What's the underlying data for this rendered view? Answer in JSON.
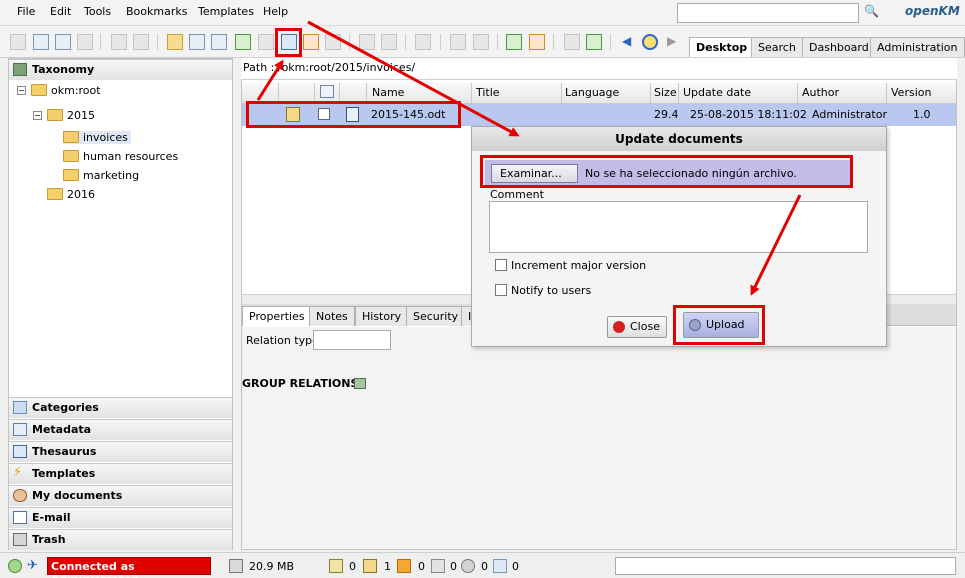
{
  "menu": [
    "File",
    "Edit",
    "Tools",
    "Bookmarks",
    "Templates",
    "Help"
  ],
  "logo": {
    "main": "penKM",
    "prefix": "o"
  },
  "search": {
    "placeholder": ""
  },
  "top_tabs": [
    "Desktop",
    "Search",
    "Dashboard",
    "Administration"
  ],
  "taxonomy": {
    "header": "Taxonomy",
    "root": "okm:root",
    "year": "2015",
    "children": [
      "invoices",
      "human resources",
      "marketing"
    ],
    "year2": "2016"
  },
  "accordions": [
    "Categories",
    "Metadata",
    "Thesaurus",
    "Templates",
    "My documents",
    "E-mail",
    "Trash"
  ],
  "path": "Path : /okm:root/2015/invoices/",
  "grid": {
    "headers": [
      "Name",
      "Title",
      "Language",
      "Size",
      "Update date",
      "Author",
      "Version"
    ],
    "row": {
      "name": "2015-145.odt",
      "size": "29.4",
      "date": "25-08-2015 18:11:02",
      "author": "Administrator",
      "version": "1.0"
    }
  },
  "props_tabs": [
    "Properties",
    "Notes",
    "History",
    "Security",
    "I"
  ],
  "relation_type_label": "Relation type",
  "group_relations": "GROUP RELATIONS",
  "dialog": {
    "title": "Update documents",
    "browse": "Examinar...",
    "file_status": "No se ha seleccionado ningún archivo.",
    "comment_label": "Comment",
    "increment": "Increment major version",
    "notify": "Notify to users",
    "close": "Close",
    "upload": "Upload"
  },
  "status": {
    "connected": "Connected as Administrator",
    "size": "20.9 MB",
    "counts": [
      "0",
      "1",
      "0",
      "0",
      "0",
      "0"
    ]
  },
  "colors": {
    "selection": "#b9c8ef",
    "annotation": "#e30000",
    "connected_bg": "#e00000"
  }
}
